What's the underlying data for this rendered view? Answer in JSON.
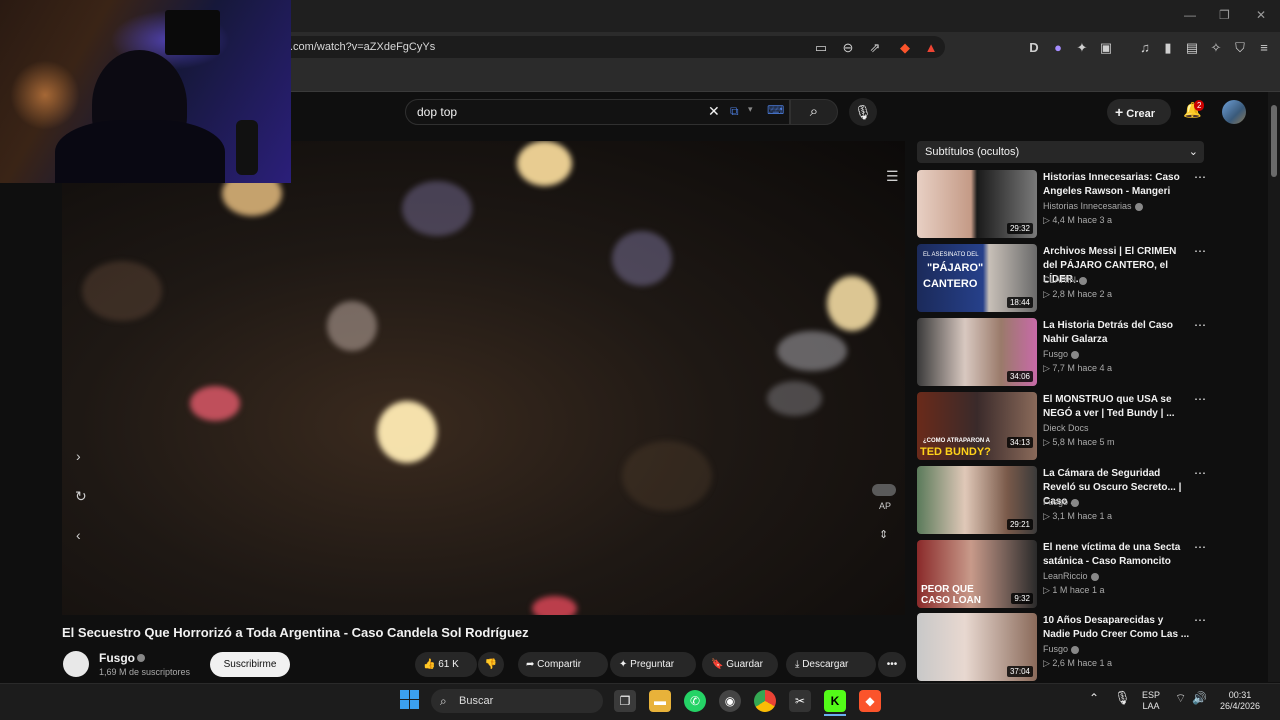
{
  "browser": {
    "url": ".com/watch?v=aZXdeFgCyYs"
  },
  "youtube_header": {
    "search_value": "dop top",
    "create_label": "Crear",
    "notification_count": "2"
  },
  "video": {
    "title": "El Secuestro Que Horrorizó a Toda Argentina - Caso Candela Sol Rodríguez",
    "channel": "Fusgo",
    "subscribers": "1,69 M de suscriptores",
    "subscribe_label": "Suscribirme",
    "likes": "61 K",
    "share_label": "Compartir",
    "ask_label": "Preguntar",
    "save_label": "Guardar",
    "download_label": "Descargar",
    "ap_label": "AP"
  },
  "sidebar": {
    "subtitles_label": "Subtítulos (ocultos)",
    "items": [
      {
        "title": "Historias Innecesarias: Caso Angeles Rawson - Mangeri",
        "channel": "Historias Innecesarias",
        "meta": "▷ 4,4 M  hace 3 a",
        "duration": "29:32",
        "thumb_bg": "linear-gradient(90deg,#e8d0c4 0%,#c49a86 45%,#1a1a1a 50%,#7a7a7a 100%)"
      },
      {
        "title": "Archivos Messi | El CRIMEN del PÁJARO CANTERO, el LÍDER ...",
        "channel": "CLARÍN",
        "meta": "▷ 2,8 M  hace 2 a",
        "duration": "18:44",
        "thumb_bg": "linear-gradient(90deg,#1b2a5a 0%,#26408a 55%,#c8c0b8 60%,#6a6a6a 100%)",
        "thumb_text1": "EL ASESINATO DEL",
        "thumb_text2": "\"PÁJARO\"",
        "thumb_text3": "CANTERO"
      },
      {
        "title": "La Historia Detrás del Caso Nahir Galarza",
        "channel": "Fusgo",
        "meta": "▷ 7,7 M  hace 4 a",
        "duration": "34:06",
        "thumb_bg": "linear-gradient(90deg,#3a3a3a 0%,#d8c8c0 40%,#9a7a6a 70%,#c86aa8 100%)"
      },
      {
        "title": "El MONSTRUO que USA se NEGÓ a ver | Ted Bundy | ...",
        "channel": "Dieck Docs",
        "meta": "▷ 5,8 M  hace 5 m",
        "duration": "34:13",
        "thumb_bg": "linear-gradient(90deg,#6a2a1a 0%,#3a2a2a 50%,#8a6a5a 100%)",
        "thumb_text1": "¿COMO ATRAPARON A",
        "thumb_text2": "TED BUNDY?"
      },
      {
        "title": "La Cámara de Seguridad Reveló su Oscuro Secreto... | Caso ...",
        "channel": "Fusgo",
        "meta": "▷ 3,1 M  hace 1 a",
        "duration": "29:21",
        "thumb_bg": "linear-gradient(90deg,#5a7a5a 0%,#e0c8b8 40%,#7a5a4a 75%,#3a3a3a 100%)"
      },
      {
        "title": "El nene víctima de una Secta satánica - Caso Ramoncito",
        "channel": "LeanRiccio",
        "meta": "▷ 1 M  hace 1 a",
        "duration": "9:32",
        "thumb_bg": "linear-gradient(90deg,#8a2a2a 0%,#c89a8a 45%,#2a2a2a 100%)",
        "thumb_text1": "PEOR QUE",
        "thumb_text2": "CASO LOAN"
      },
      {
        "title": "10 Años Desaparecidas y Nadie Pudo Creer Como Las ...",
        "channel": "Fusgo",
        "meta": "▷ 2,6 M  hace 1 a",
        "duration": "37:04",
        "thumb_bg": "linear-gradient(90deg,#c8c8c8 0%,#e8d8d0 40%,#8a6a5a 100%)"
      }
    ]
  },
  "taskbar": {
    "search_label": "Buscar",
    "lang_line1": "ESP",
    "lang_line2": "LAA",
    "time": "00:31",
    "date": "26/4/2026"
  },
  "colors": {
    "background": "#0f0f0f",
    "accent_red": "#cc0000",
    "text_primary": "#f1f1f1",
    "text_secondary": "#aaaaaa"
  }
}
